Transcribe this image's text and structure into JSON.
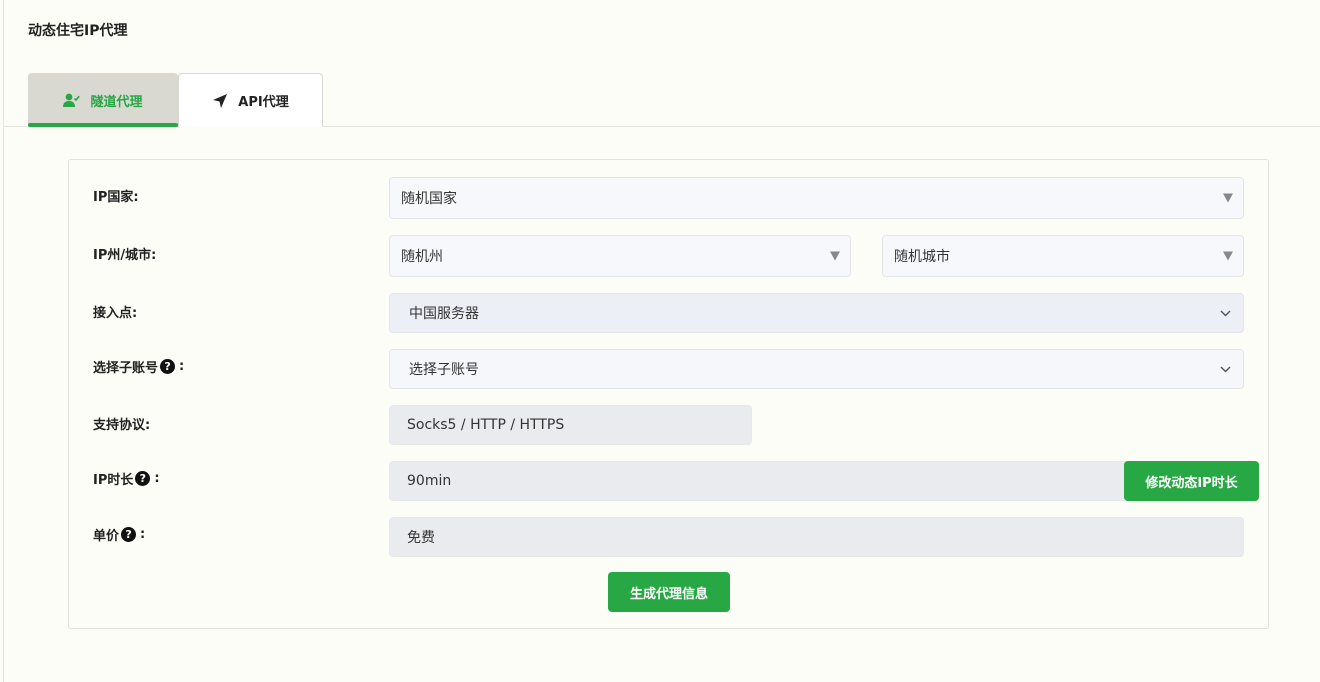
{
  "page": {
    "title": "动态住宅IP代理"
  },
  "tabs": [
    {
      "label": "隧道代理",
      "active": true
    },
    {
      "label": "API代理",
      "active": false
    }
  ],
  "form": {
    "country": {
      "label": "IP国家:",
      "value": "随机国家"
    },
    "state_city": {
      "label": "IP州/城市:",
      "state_value": "随机州",
      "city_value": "随机城市"
    },
    "access_point": {
      "label": "接入点:",
      "value": "中国服务器"
    },
    "sub_account": {
      "label": "选择子账号",
      "colon": ":",
      "value": "选择子账号"
    },
    "protocol": {
      "label": "支持协议:",
      "value": "Socks5 / HTTP / HTTPS"
    },
    "duration": {
      "label": "IP时长",
      "colon": ":",
      "value": "90min",
      "modify_button": "修改动态IP时长"
    },
    "price": {
      "label": "单价",
      "colon": ":",
      "value": "免费"
    },
    "generate_button": "生成代理信息"
  },
  "colors": {
    "accent": "#28a745",
    "active_tab_bg": "#d9d9d2"
  },
  "icons": {
    "tunnel_tab": "user-check-icon",
    "api_tab": "location-arrow-icon",
    "help": "question-circle-icon"
  }
}
